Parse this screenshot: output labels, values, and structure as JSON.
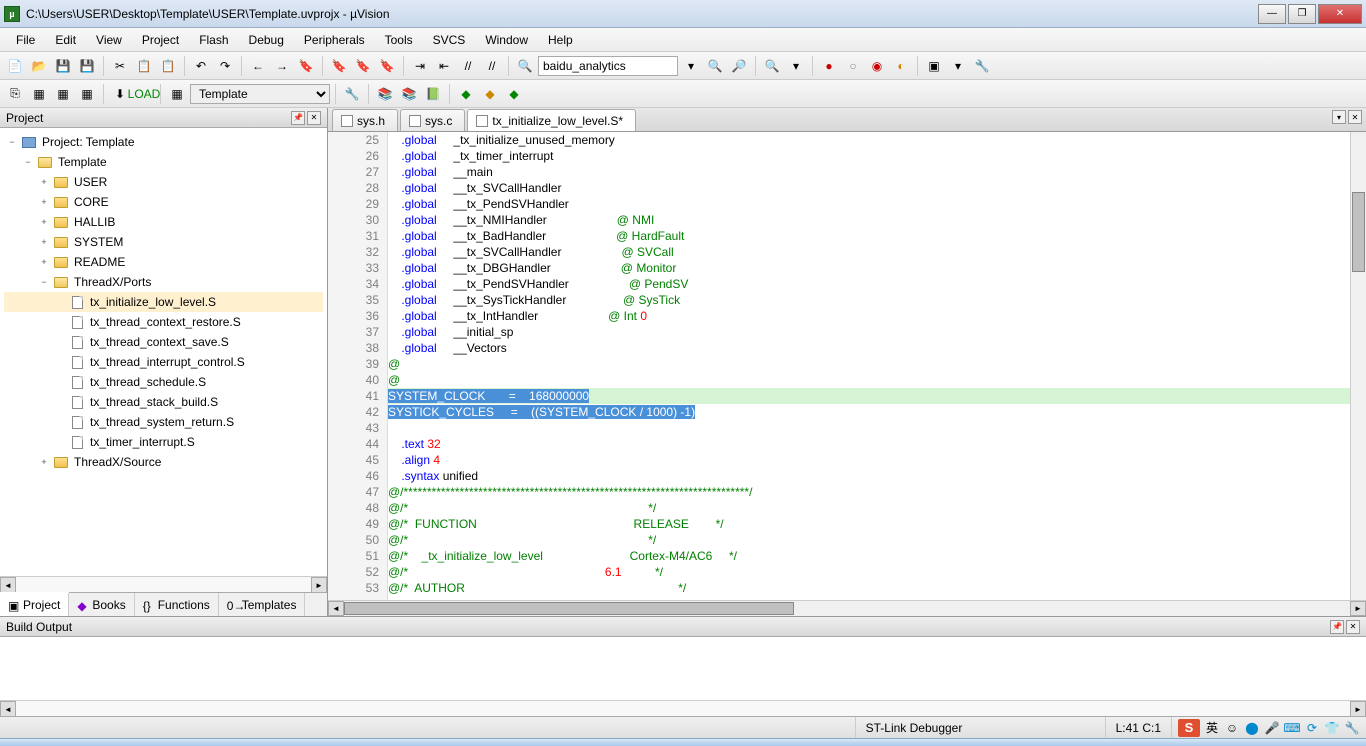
{
  "title": "C:\\Users\\USER\\Desktop\\Template\\USER\\Template.uvprojx - µVision",
  "menus": [
    "File",
    "Edit",
    "View",
    "Project",
    "Flash",
    "Debug",
    "Peripherals",
    "Tools",
    "SVCS",
    "Window",
    "Help"
  ],
  "search_box": "baidu_analytics",
  "target_combo": "Template",
  "project_panel": {
    "title": "Project",
    "tree": {
      "root": {
        "label": "Project: Template"
      },
      "target": {
        "label": "Template"
      },
      "groups": [
        "USER",
        "CORE",
        "HALLIB",
        "SYSTEM",
        "README"
      ],
      "ports": {
        "label": "ThreadX/Ports",
        "files": [
          "tx_initialize_low_level.S",
          "tx_thread_context_restore.S",
          "tx_thread_context_save.S",
          "tx_thread_interrupt_control.S",
          "tx_thread_schedule.S",
          "tx_thread_stack_build.S",
          "tx_thread_system_return.S",
          "tx_timer_interrupt.S"
        ]
      },
      "source": {
        "label": "ThreadX/Source"
      }
    },
    "tabs": [
      "Project",
      "Books",
      "Functions",
      "Templates"
    ]
  },
  "editor_tabs": [
    {
      "label": "sys.h",
      "active": false
    },
    {
      "label": "sys.c",
      "active": false
    },
    {
      "label": "tx_initialize_low_level.S*",
      "active": true
    }
  ],
  "code_lines": [
    {
      "n": 25,
      "t": "    .global     _tx_initialize_unused_memory"
    },
    {
      "n": 26,
      "t": "    .global     _tx_timer_interrupt"
    },
    {
      "n": 27,
      "t": "    .global     __main"
    },
    {
      "n": 28,
      "t": "    .global     __tx_SVCallHandler"
    },
    {
      "n": 29,
      "t": "    .global     __tx_PendSVHandler"
    },
    {
      "n": 30,
      "t": "    .global     __tx_NMIHandler                     @ NMI"
    },
    {
      "n": 31,
      "t": "    .global     __tx_BadHandler                     @ HardFault"
    },
    {
      "n": 32,
      "t": "    .global     __tx_SVCallHandler                  @ SVCall"
    },
    {
      "n": 33,
      "t": "    .global     __tx_DBGHandler                     @ Monitor"
    },
    {
      "n": 34,
      "t": "    .global     __tx_PendSVHandler                  @ PendSV"
    },
    {
      "n": 35,
      "t": "    .global     __tx_SysTickHandler                 @ SysTick"
    },
    {
      "n": 36,
      "t": "    .global     __tx_IntHandler                     @ Int 0"
    },
    {
      "n": 37,
      "t": "    .global     __initial_sp"
    },
    {
      "n": 38,
      "t": "    .global     __Vectors"
    },
    {
      "n": 39,
      "t": "@"
    },
    {
      "n": 40,
      "t": "@"
    },
    {
      "n": 41,
      "t": "SYSTEM_CLOCK       =    168000000",
      "sel": true,
      "cur": true
    },
    {
      "n": 42,
      "t": "SYSTICK_CYCLES     =    ((SYSTEM_CLOCK / 1000) -1)",
      "sel": true
    },
    {
      "n": 43,
      "t": ""
    },
    {
      "n": 44,
      "t": "    .text 32"
    },
    {
      "n": 45,
      "t": "    .align 4"
    },
    {
      "n": 46,
      "t": "    .syntax unified"
    },
    {
      "n": 47,
      "t": "@/**************************************************************************/"
    },
    {
      "n": 48,
      "t": "@/*                                                                        */"
    },
    {
      "n": 49,
      "t": "@/*  FUNCTION                                               RELEASE        */"
    },
    {
      "n": 50,
      "t": "@/*                                                                        */"
    },
    {
      "n": 51,
      "t": "@/*    _tx_initialize_low_level                          Cortex-M4/AC6     */"
    },
    {
      "n": 52,
      "t": "@/*                                                           6.1          */"
    },
    {
      "n": 53,
      "t": "@/*  AUTHOR                                                                */"
    }
  ],
  "output_panel": {
    "title": "Build Output"
  },
  "status": {
    "debugger": "ST-Link Debugger",
    "pos": "L:41 C:1",
    "ime": "S",
    "lang": "英"
  }
}
